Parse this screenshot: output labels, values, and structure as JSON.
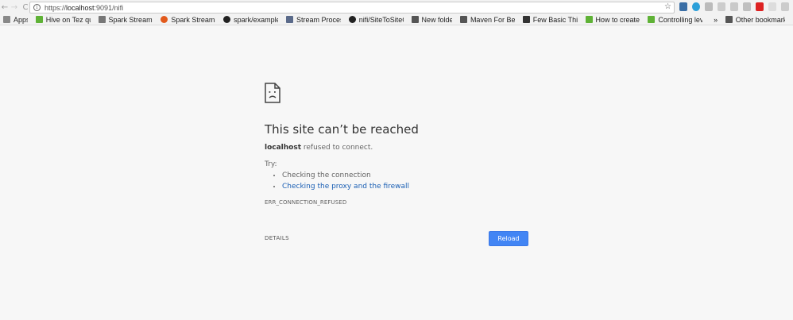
{
  "browser": {
    "back_glyph": "←",
    "forward_glyph": "→",
    "reload_glyph": "C",
    "url_scheme": "https://",
    "url_host": "localhost",
    "url_rest": ":9091/nifi",
    "star_glyph": "☆"
  },
  "bookmarks": [
    {
      "label": "Apps",
      "icon": "apps-icon",
      "color": "#888888"
    },
    {
      "label": "Hive on Tez query",
      "icon": "hortonworks-icon",
      "color": "#5fb236"
    },
    {
      "label": "Spark Streaming -",
      "icon": "page-icon",
      "color": "#777777"
    },
    {
      "label": "Spark Streaming -",
      "icon": "spark-icon",
      "color": "#e25a1c"
    },
    {
      "label": "spark/examples/s",
      "icon": "github-icon",
      "color": "#222222"
    },
    {
      "label": "Stream Processing",
      "icon": "stream-icon",
      "color": "#5a6a8a"
    },
    {
      "label": "nifi/SiteToSiteCli",
      "icon": "github-icon",
      "color": "#222222"
    },
    {
      "label": "New folder",
      "icon": "folder-icon",
      "color": "#555555"
    },
    {
      "label": "Maven For Beginn",
      "icon": "folder-icon",
      "color": "#555555"
    },
    {
      "label": "Few Basic Things",
      "icon": "grid-icon",
      "color": "#333333"
    },
    {
      "label": "How to create use",
      "icon": "hortonworks-icon",
      "color": "#5fb236"
    },
    {
      "label": "Controlling level c",
      "icon": "hortonworks-icon",
      "color": "#5fb236"
    },
    {
      "label": "»",
      "icon": "",
      "color": ""
    },
    {
      "label": "Other bookmarks",
      "icon": "folder-icon",
      "color": "#555555"
    }
  ],
  "error": {
    "headline": "This site can’t be reached",
    "host": "localhost",
    "desc_rest": " refused to connect.",
    "try_label": "Try:",
    "suggestion_1": "Checking the connection",
    "suggestion_2": "Checking the proxy and the firewall",
    "code": "ERR_CONNECTION_REFUSED",
    "details_label": "DETAILS",
    "reload_label": "Reload"
  }
}
